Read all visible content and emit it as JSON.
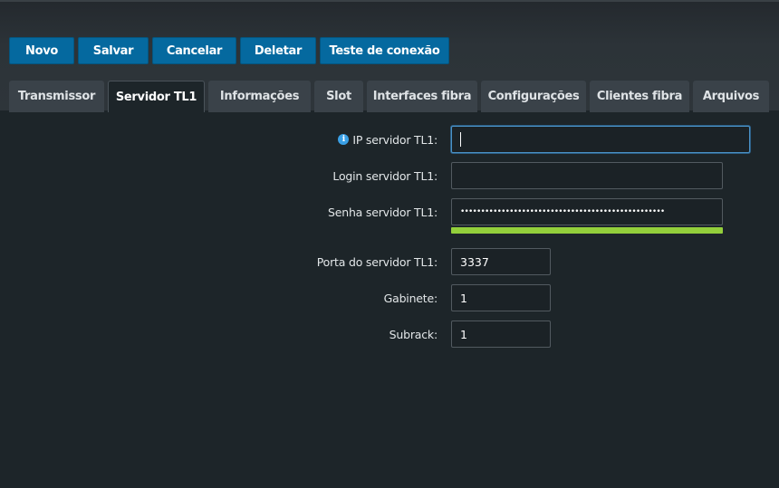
{
  "toolbar": {
    "novo": "Novo",
    "salvar": "Salvar",
    "cancelar": "Cancelar",
    "deletar": "Deletar",
    "teste": "Teste de conexão"
  },
  "tabs": [
    {
      "label": "Transmissor",
      "active": false
    },
    {
      "label": "Servidor TL1",
      "active": true
    },
    {
      "label": "Informações",
      "active": false
    },
    {
      "label": "Slot",
      "active": false
    },
    {
      "label": "Interfaces fibra",
      "active": false
    },
    {
      "label": "Configurações",
      "active": false
    },
    {
      "label": "Clientes fibra",
      "active": false
    },
    {
      "label": "Arquivos",
      "active": false
    }
  ],
  "form": {
    "ip": {
      "label": "IP servidor TL1:",
      "value": "",
      "icon": "info-icon"
    },
    "login": {
      "label": "Login servidor TL1:",
      "value": ""
    },
    "senha": {
      "label": "Senha servidor TL1:",
      "value": "••••••••••••••••••••••••••••••••••••••••••••••••••",
      "strength_fraction": 1.0,
      "strength_color": "#93cf3b"
    },
    "porta": {
      "label": "Porta do servidor TL1:",
      "value": "3337"
    },
    "gabinete": {
      "label": "Gabinete:",
      "value": "1"
    },
    "subrack": {
      "label": "Subrack:",
      "value": "1"
    }
  },
  "colors": {
    "button": "#05699f",
    "background": "#1d2529",
    "tab": "#3a4249",
    "focus": "#4a92c7"
  }
}
